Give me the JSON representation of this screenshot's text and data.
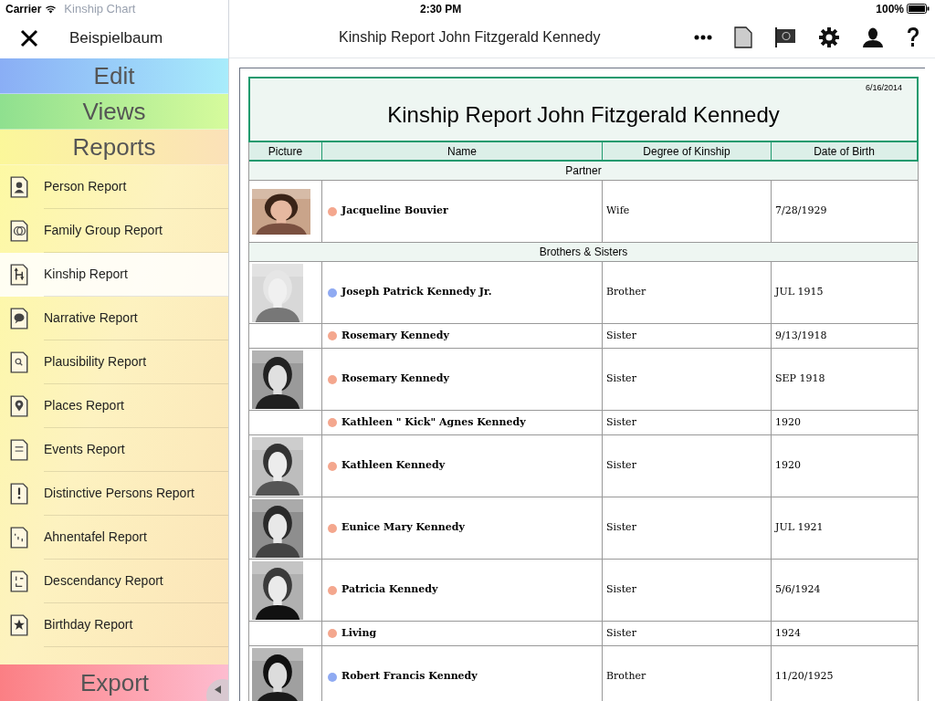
{
  "status_bar": {
    "carrier": "Carrier",
    "time": "2:30 PM",
    "battery": "100%"
  },
  "sidebar": {
    "ghost_text": "Kinship Chart",
    "title": "Beispielbaum",
    "sections": [
      {
        "label": "Edit",
        "kind": "edit"
      },
      {
        "label": "Views",
        "kind": "views"
      },
      {
        "label": "Reports",
        "kind": "reports"
      }
    ],
    "items": [
      {
        "label": "Person Report",
        "selected": false
      },
      {
        "label": "Family Group Report",
        "selected": false
      },
      {
        "label": "Kinship Report",
        "selected": true
      },
      {
        "label": "Narrative Report",
        "selected": false
      },
      {
        "label": "Plausibility Report",
        "selected": false
      },
      {
        "label": "Places Report",
        "selected": false
      },
      {
        "label": "Events Report",
        "selected": false
      },
      {
        "label": "Distinctive Persons Report",
        "selected": false
      },
      {
        "label": "Ahnentafel Report",
        "selected": false
      },
      {
        "label": "Descendancy Report",
        "selected": false
      },
      {
        "label": "Birthday Report",
        "selected": false
      }
    ],
    "export": "Export"
  },
  "navbar": {
    "title": "Kinship Report John Fitzgerald Kennedy"
  },
  "report": {
    "date": "6/16/2014",
    "title": "Kinship Report John Fitzgerald Kennedy",
    "columns": [
      "Picture",
      "Name",
      "Degree of Kinship",
      "Date of Birth"
    ],
    "rows": [
      {
        "kind": "group",
        "label": "Partner"
      },
      {
        "kind": "person",
        "has_picture": true,
        "name": "Jacqueline Bouvier",
        "color": "#f4a78e",
        "degree": "Wife",
        "birth": "7/28/1929"
      },
      {
        "kind": "group",
        "label": "Brothers & Sisters"
      },
      {
        "kind": "person",
        "has_picture": true,
        "name": "Joseph Patrick Kennedy Jr.",
        "color": "#8faaf2",
        "degree": "Brother",
        "birth": "JUL 1915"
      },
      {
        "kind": "person",
        "has_picture": false,
        "name": "Rosemary Kennedy",
        "color": "#f4a78e",
        "degree": "Sister",
        "birth": "9/13/1918"
      },
      {
        "kind": "person",
        "has_picture": true,
        "name": "Rosemary Kennedy",
        "color": "#f4a78e",
        "degree": "Sister",
        "birth": "SEP 1918"
      },
      {
        "kind": "person",
        "has_picture": false,
        "name": "Kathleen \" Kick\" Agnes Kennedy",
        "color": "#f4a78e",
        "degree": "Sister",
        "birth": "1920"
      },
      {
        "kind": "person",
        "has_picture": true,
        "name": "Kathleen Kennedy",
        "color": "#f4a78e",
        "degree": "Sister",
        "birth": "1920"
      },
      {
        "kind": "person",
        "has_picture": true,
        "name": "Eunice Mary Kennedy",
        "color": "#f4a78e",
        "degree": "Sister",
        "birth": "JUL 1921"
      },
      {
        "kind": "person",
        "has_picture": true,
        "name": "Patricia Kennedy",
        "color": "#f4a78e",
        "degree": "Sister",
        "birth": "5/6/1924"
      },
      {
        "kind": "person",
        "has_picture": false,
        "name": "Living",
        "color": "#f4a78e",
        "degree": "Sister",
        "birth": "1924"
      },
      {
        "kind": "person",
        "has_picture": true,
        "name": "Robert Francis Kennedy",
        "color": "#8faaf2",
        "degree": "Brother",
        "birth": "11/20/1925"
      }
    ]
  }
}
